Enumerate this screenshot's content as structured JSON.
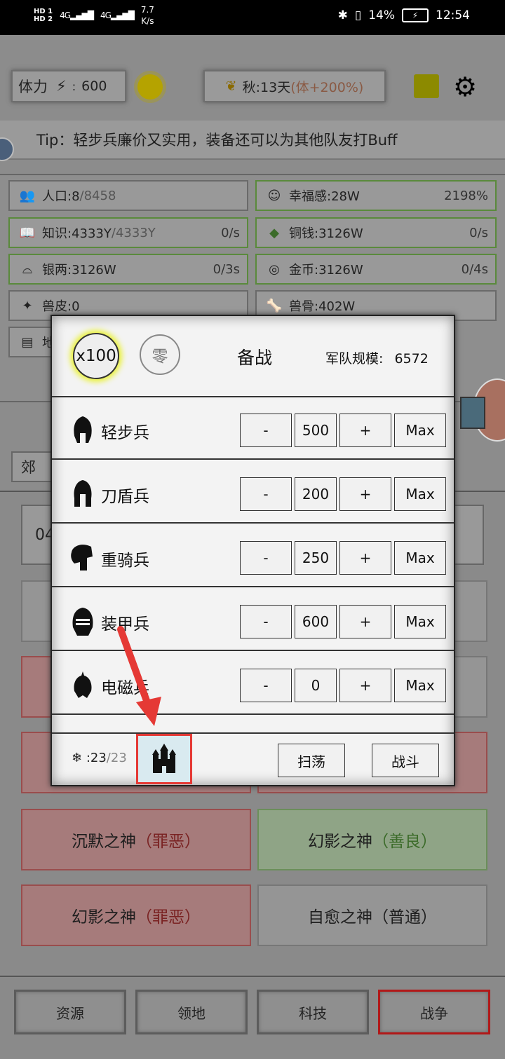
{
  "status_bar": {
    "hd1": "HD 1",
    "hd2": "HD 2",
    "net1": "4G",
    "net2": "4G",
    "speed_value": "7.7",
    "speed_unit": "K/s",
    "battery": "14%",
    "time": "12:54"
  },
  "top": {
    "stamina_label": "体力",
    "stamina_value": "600",
    "season": "秋:13天",
    "season_bonus": "(体+200%)"
  },
  "tip": "Tip：轻步兵廉价又实用，装备还可以为其他队友打Buff",
  "resources": [
    {
      "label": "人口:8",
      "extra": "/8458",
      "rate": ""
    },
    {
      "label": "幸福感:28W",
      "extra": "",
      "rate": "2198%"
    },
    {
      "label": "知识:4333Y",
      "extra": "/4333Y",
      "rate": "0/s"
    },
    {
      "label": "铜钱:3126W",
      "extra": "",
      "rate": "0/s"
    },
    {
      "label": "银两:3126W",
      "extra": "",
      "rate": "0/3s"
    },
    {
      "label": "金币:3126W",
      "extra": "",
      "rate": "0/4s"
    },
    {
      "label": "兽皮:0",
      "extra": "",
      "rate": ""
    },
    {
      "label": "兽骨:402W",
      "extra": "",
      "rate": ""
    },
    {
      "label": "地",
      "extra": "",
      "rate": ""
    }
  ],
  "bg": {
    "tab_partial": "郊",
    "row_partial": "04"
  },
  "god_cards": [
    {
      "name": "沉默之神",
      "tag": "（罪恶）"
    },
    {
      "name": "幻影之神",
      "tag": "（善良）"
    },
    {
      "name": "幻影之神",
      "tag": "（罪恶）"
    },
    {
      "name": "自愈之神",
      "tag": "（普通）"
    }
  ],
  "nav": [
    "资源",
    "领地",
    "科技",
    "战争"
  ],
  "modal": {
    "multiplier": "x100",
    "zero": "零",
    "title": "备战",
    "army_scale_label": "军队规模:",
    "army_scale_value": "6572",
    "units": [
      {
        "name": "轻步兵",
        "count": "500"
      },
      {
        "name": "刀盾兵",
        "count": "200"
      },
      {
        "name": "重骑兵",
        "count": "250"
      },
      {
        "name": "装甲兵",
        "count": "600"
      },
      {
        "name": "电磁兵",
        "count": "0"
      }
    ],
    "minus": "-",
    "plus": "+",
    "max": "Max",
    "stamina_current": ":23",
    "stamina_max": "/23",
    "sweep": "扫荡",
    "fight": "战斗"
  }
}
